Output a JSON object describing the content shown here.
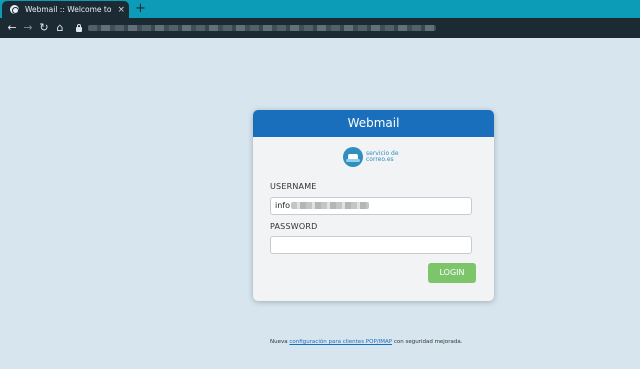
{
  "browser": {
    "tab_title": "Webmail :: Welcome to Webmail",
    "tab_close": "×",
    "new_tab": "+",
    "icons": [
      "globe-icon",
      "back-icon",
      "forward-icon",
      "reload-icon",
      "home-icon",
      "lock-icon"
    ]
  },
  "login": {
    "header": "Webmail",
    "logo_line1": "servicio de",
    "logo_line2": "correo.es",
    "username_label": "USERNAME",
    "username_value": "info",
    "password_label": "PASSWORD",
    "password_value": "",
    "button_label": "LOGIN"
  },
  "footer": {
    "prefix": "Nueva",
    "link_text": "configuración para clientes POP/IMAP",
    "suffix": "con seguridad mejorada."
  },
  "colors": {
    "page_bg": "#d7e5ef",
    "header_blue": "#1a6fbd",
    "login_green": "#7cc56a",
    "chrome_teal": "#0d9cb8",
    "chrome_dark": "#1b2a33"
  }
}
